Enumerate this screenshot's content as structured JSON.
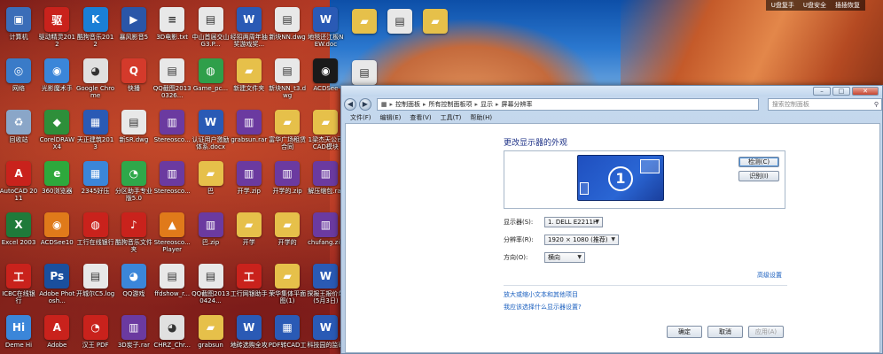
{
  "desktop": {
    "tray_strip": [
      "U盘复手",
      "U盘安全",
      "插插恢复"
    ],
    "icons": [
      {
        "label": "计算机",
        "color": "#3b6db8",
        "glyph": "▣"
      },
      {
        "label": "驱动精灵2012",
        "color": "#c9221c",
        "glyph": "驱"
      },
      {
        "label": "酷狗音乐2012",
        "color": "#1a7fd6",
        "glyph": "K"
      },
      {
        "label": "暴风影音5",
        "color": "#2a56a8",
        "glyph": "▶"
      },
      {
        "label": "3D电影.txt",
        "color": "#e8e8e8",
        "glyph": "≡"
      },
      {
        "label": "中山首届交山G3.P...",
        "color": "#e8e8e8",
        "glyph": "▤"
      },
      {
        "label": "经招两周年抽奖游戏奖...",
        "color": "#2a5ab5",
        "glyph": "W"
      },
      {
        "label": "新块NN.dwg",
        "color": "#e8e8e8",
        "glyph": "▤"
      },
      {
        "label": "地毯还江板NEW.doc",
        "color": "#2a5ab5",
        "glyph": "W"
      },
      {
        "label": "网络",
        "color": "#3a7bc8",
        "glyph": "◎"
      },
      {
        "label": "光影魔术手",
        "color": "#3b86d9",
        "glyph": "◉"
      },
      {
        "label": "Google Chrome",
        "color": "#e0e0e0",
        "glyph": "◕"
      },
      {
        "label": "快播",
        "color": "#d43a2b",
        "glyph": "Q"
      },
      {
        "label": "QQ截图20130326...",
        "color": "#e8e8e8",
        "glyph": "▤"
      },
      {
        "label": "Game_pc...",
        "color": "#2f9f4a",
        "glyph": "◍"
      },
      {
        "label": "新建文件夹",
        "color": "#e6c04a",
        "glyph": "▰"
      },
      {
        "label": "新块NN_t3.dwg",
        "color": "#e8e8e8",
        "glyph": "▤"
      },
      {
        "label": "ACDSee",
        "color": "#1a1a1a",
        "glyph": "◉"
      },
      {
        "label": "回收站",
        "color": "#8aa6c8",
        "glyph": "♻"
      },
      {
        "label": "CorelDRAW X4",
        "color": "#2e8f3a",
        "glyph": "◆"
      },
      {
        "label": "天正建筑2013",
        "color": "#2a5ab5",
        "glyph": "▦"
      },
      {
        "label": "新SR.dwg",
        "color": "#e8e8e8",
        "glyph": "▤"
      },
      {
        "label": "Stereosco...",
        "color": "#6b3aa0",
        "glyph": "▥"
      },
      {
        "label": "认证用户激励体系.docx",
        "color": "#2a5ab5",
        "glyph": "W"
      },
      {
        "label": "grabsun.rar",
        "color": "#6b3aa0",
        "glyph": "▥"
      },
      {
        "label": "富华广场租赁合同",
        "color": "#e6c04a",
        "glyph": "▰"
      },
      {
        "label": "1梁杰天公司CAD模块",
        "color": "#e6c04a",
        "glyph": "▰"
      },
      {
        "label": "AutoCAD 2011",
        "color": "#c9221c",
        "glyph": "A"
      },
      {
        "label": "360浏览器",
        "color": "#2ea83c",
        "glyph": "e"
      },
      {
        "label": "2345好压",
        "color": "#3b86d9",
        "glyph": "▦"
      },
      {
        "label": "分区助手专业版5.0",
        "color": "#2fa84a",
        "glyph": "◔"
      },
      {
        "label": "Stereosco...",
        "color": "#6b3aa0",
        "glyph": "▥"
      },
      {
        "label": "巴",
        "color": "#e6c04a",
        "glyph": "▰"
      },
      {
        "label": "开学.zip",
        "color": "#6b3aa0",
        "glyph": "▥"
      },
      {
        "label": "开学的.zip",
        "color": "#6b3aa0",
        "glyph": "▥"
      },
      {
        "label": "解压缩包.rar",
        "color": "#6b3aa0",
        "glyph": "▥"
      },
      {
        "label": "Excel 2003",
        "color": "#1f7a3a",
        "glyph": "X"
      },
      {
        "label": "ACDSee10",
        "color": "#e07a1a",
        "glyph": "◉"
      },
      {
        "label": "工行在线银行",
        "color": "#c9221c",
        "glyph": "◍"
      },
      {
        "label": "酷狗音乐文件夹",
        "color": "#c9221c",
        "glyph": "♪"
      },
      {
        "label": "Stereosco... Player",
        "color": "#e07a1a",
        "glyph": "▲"
      },
      {
        "label": "巴.zip",
        "color": "#6b3aa0",
        "glyph": "▥"
      },
      {
        "label": "开学",
        "color": "#e6c04a",
        "glyph": "▰"
      },
      {
        "label": "开学的",
        "color": "#e6c04a",
        "glyph": "▰"
      },
      {
        "label": "chufang.zip",
        "color": "#6b3aa0",
        "glyph": "▥"
      },
      {
        "label": "ICBC在线银行",
        "color": "#c9221c",
        "glyph": "工"
      },
      {
        "label": "Adobe Photosh...",
        "color": "#1a4f9e",
        "glyph": "Ps"
      },
      {
        "label": "开城尔C5.log",
        "color": "#e8e8e8",
        "glyph": "▤"
      },
      {
        "label": "QQ游戏",
        "color": "#3b86d9",
        "glyph": "◕"
      },
      {
        "label": "ffdshow_r...",
        "color": "#e8e8e8",
        "glyph": "▤"
      },
      {
        "label": "QQ截图20130424...",
        "color": "#e8e8e8",
        "glyph": "▤"
      },
      {
        "label": "工行网银助手",
        "color": "#c9221c",
        "glyph": "工"
      },
      {
        "label": "荣华集体平面图(1)",
        "color": "#e6c04a",
        "glyph": "▰"
      },
      {
        "label": "探报王报价单(5月3日)",
        "color": "#2a5ab5",
        "glyph": "W"
      },
      {
        "label": "Deme Hi",
        "color": "#3b86d9",
        "glyph": "Hi"
      },
      {
        "label": "Adobe",
        "color": "#c9221c",
        "glyph": "A"
      },
      {
        "label": "汉王 PDF",
        "color": "#c9221c",
        "glyph": "◔"
      },
      {
        "label": "3D炭子.rar",
        "color": "#6b3aa0",
        "glyph": "▥"
      },
      {
        "label": "CHRZ_Chr...",
        "color": "#e0e0e0",
        "glyph": "◕"
      },
      {
        "label": "grabsun",
        "color": "#e6c04a",
        "glyph": "▰"
      },
      {
        "label": "地砖选购全攻",
        "color": "#2a5ab5",
        "glyph": "W"
      },
      {
        "label": "PDF转CAD工",
        "color": "#2a5ab5",
        "glyph": "▦"
      },
      {
        "label": "科技园的监码",
        "color": "#2a5ab5",
        "glyph": "W"
      }
    ],
    "wall_icons": [
      {
        "label": "",
        "color": "#e6c04a",
        "glyph": "▰"
      },
      {
        "label": "",
        "color": "#e8e8e8",
        "glyph": "▤"
      },
      {
        "label": "",
        "color": "#e6c04a",
        "glyph": "▰"
      },
      {
        "label": "",
        "color": "#e8e8e8",
        "glyph": "▤"
      }
    ]
  },
  "window": {
    "address": [
      "控制面板",
      "所有控制面板项",
      "显示",
      "屏幕分辨率"
    ],
    "search_placeholder": "搜索控制面板",
    "menu": [
      "文件(F)",
      "编辑(E)",
      "查看(V)",
      "工具(T)",
      "帮助(H)"
    ],
    "heading": "更改显示器的外观",
    "monitor_number": "1",
    "detect_label": "检测(C)",
    "identify_label": "识别(I)",
    "display_label": "显示器(S):",
    "display_value": "1. DELL E2211H",
    "resolution_label": "分辨率(R):",
    "resolution_value": "1920 × 1080 (推荐)",
    "orientation_label": "方向(O):",
    "orientation_value": "横向",
    "advanced_label": "高级设置",
    "link_text_size": "放大或缩小文本和其他项目",
    "link_which_setting": "我应该选择什么显示器设置?",
    "ok_label": "确定",
    "cancel_label": "取消",
    "apply_label": "应用(A)"
  }
}
